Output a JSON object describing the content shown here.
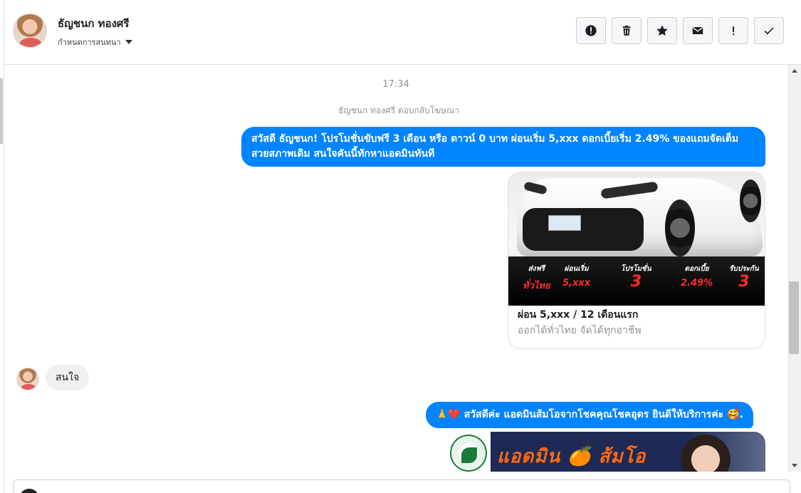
{
  "header": {
    "contact_name": "ธัญชนก ทองศรี",
    "conversation_settings": "กำหนดการสนทนา",
    "toolbar_icons": [
      "report-icon",
      "trash-icon",
      "star-icon",
      "envelope-icon",
      "exclamation-icon",
      "checkmark-icon"
    ]
  },
  "messages": {
    "time_separator": "17:34",
    "reply_note": "ธัญชนก ทองศรี ตอบกลับโฆษณา",
    "outgoing_1": "สวัสดี ธัญชนก! โปรโมชั่นขับฟรี 3 เดือน หรือ ดาวน์ 0 บาท ผ่อนเริ่ม 5,xxx ดอกเบี้ยเริ่ม 2.49% ของแถมจัดเต็ม สวยสภาพเดิม สนใจคันนี้ทักหาแอดมินทันที",
    "ad_card": {
      "title": "ผ่อน 5,xxx / 12 เดือนแรก",
      "subtitle": "ออกได้ทั่วไทย จัดได้ทุกอาชีพ",
      "promo": [
        {
          "head": "ส่งฟรี",
          "value": "ทั่วไทย"
        },
        {
          "head": "ผ่อนเริ่ม",
          "value": "5,xxx"
        },
        {
          "head": "โปรโมชั่น",
          "value": "3"
        },
        {
          "head": "ดอกเบี้ย",
          "value": "2.49%"
        },
        {
          "head": "รับประกัน",
          "value": "3"
        }
      ]
    },
    "incoming_1": "สนใจ",
    "outgoing_2": "🙏❤️ สวัสดีค่ะ แอดมินส้มโอจากโชคคุณโชคอุดร ยินดีให้บริการค่ะ 🥰.",
    "banner_text": "แอดมิน 🍊 ส้มโอ"
  },
  "colors": {
    "accent": "#0084ff",
    "incoming_bubble": "#f1f0f0",
    "promo_red": "#ff2b2b"
  }
}
